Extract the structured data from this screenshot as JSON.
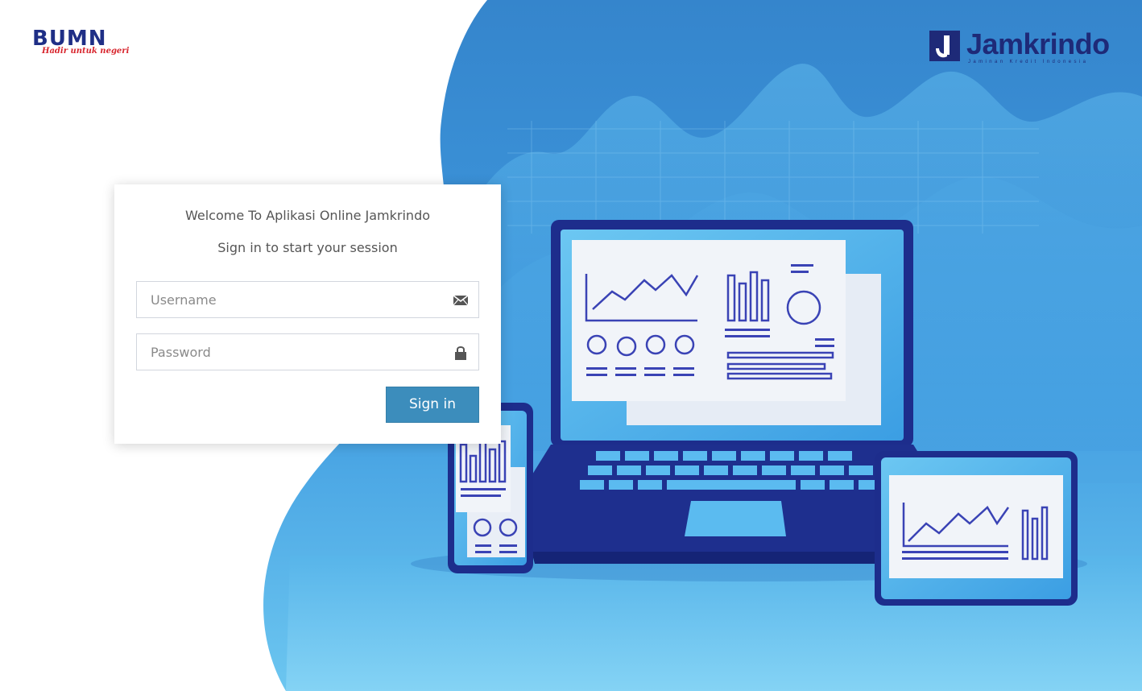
{
  "brand_left": {
    "name": "BUMN",
    "tagline": "Hadir untuk negeri"
  },
  "brand_right": {
    "name": "Jamkrindo",
    "subtitle": "Jaminan Kredit Indonesia"
  },
  "login": {
    "welcome": "Welcome To Aplikasi Online Jamkrindo",
    "subtitle": "Sign in to start your session",
    "username_placeholder": "Username",
    "password_placeholder": "Password",
    "submit_label": "Sign in"
  },
  "icons": {
    "username": "envelope-icon",
    "password": "lock-icon"
  },
  "colors": {
    "primary_button": "#3c8dbc",
    "brand_navy": "#1e2a78",
    "hero_blue": "#3b8fd4"
  }
}
